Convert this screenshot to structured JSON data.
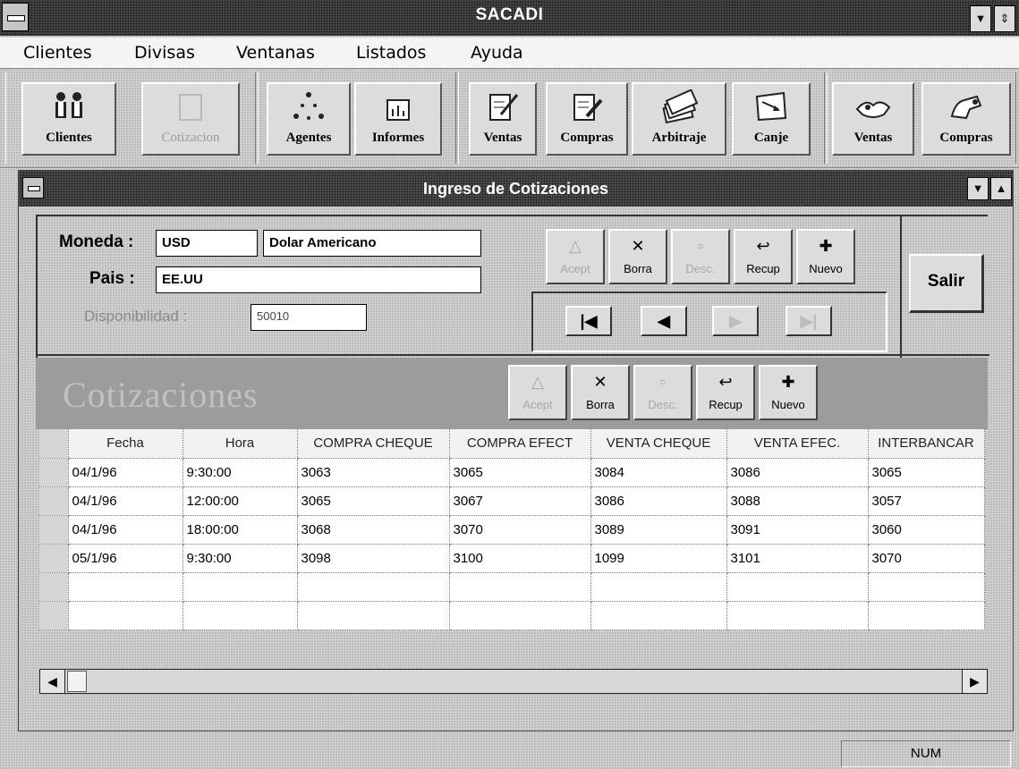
{
  "app": {
    "title": "SACADI"
  },
  "menu": [
    "Clientes",
    "Divisas",
    "Ventanas",
    "Listados",
    "Ayuda"
  ],
  "toolbar": {
    "clientes": "Clientes",
    "cotizacion": "Cotizacion",
    "agentes": "Agentes",
    "informes": "Informes",
    "ventas": "Ventas",
    "compras": "Compras",
    "arbitraje": "Arbitraje",
    "canje": "Canje",
    "ventas2": "Ventas",
    "compras2": "Compras"
  },
  "window": {
    "title": "Ingreso de Cotizaciones"
  },
  "form": {
    "moneda_label": "Moneda :",
    "moneda_code": "USD",
    "moneda_name": "Dolar Americano",
    "pais_label": "Pais :",
    "pais_value": "EE.UU",
    "disponibilidad_label": "Disponibilidad :",
    "disponibilidad_value": "50010"
  },
  "actions": {
    "acept": "Acept",
    "borra": "Borra",
    "desc": "Desc.",
    "recup": "Recup",
    "nuevo": "Nuevo",
    "salir": "Salir"
  },
  "section": {
    "title": "Cotizaciones"
  },
  "table": {
    "columns": [
      "Fecha",
      "Hora",
      "COMPRA CHEQUE",
      "COMPRA EFECT",
      "VENTA CHEQUE",
      "VENTA EFEC.",
      "INTERBANCAR"
    ],
    "rows": [
      [
        "04/1/96",
        "9:30:00",
        "3063",
        "3065",
        "3084",
        "3086",
        "3065"
      ],
      [
        "04/1/96",
        "12:00:00",
        "3065",
        "3067",
        "3086",
        "3088",
        "3057"
      ],
      [
        "04/1/96",
        "18:00:00",
        "3068",
        "3070",
        "3089",
        "3091",
        "3060"
      ],
      [
        "05/1/96",
        "9:30:00",
        "3098",
        "3100",
        "1099",
        "3101",
        "3070"
      ]
    ]
  },
  "status": {
    "num": "NUM"
  }
}
